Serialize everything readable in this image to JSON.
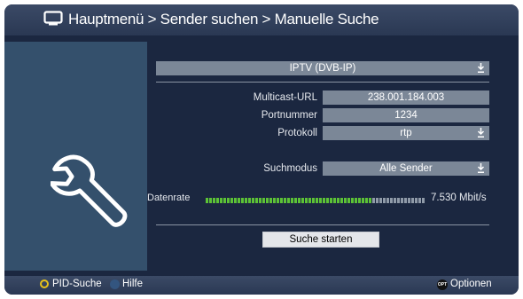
{
  "header": {
    "title": "Hauptmenü > Sender suchen > Manuelle Suche"
  },
  "source_select": {
    "value": "IPTV (DVB-IP)"
  },
  "form": {
    "multicast_url": {
      "label": "Multicast-URL",
      "value": "238.001.184.003"
    },
    "port": {
      "label": "Portnummer",
      "value": "1234"
    },
    "protocol": {
      "label": "Protokoll",
      "value": "rtp"
    },
    "search_mode": {
      "label": "Suchmodus",
      "value": "Alle Sender"
    }
  },
  "datarate": {
    "label": "Datenrate",
    "value": "7.530 Mbit/s",
    "level": 0.76,
    "filled_color": "#5cc236",
    "empty_color": "#8f9aa8"
  },
  "start_button": {
    "label": "Suche starten"
  },
  "footer": {
    "pid_search": {
      "label": "PID-Suche",
      "button_color": "#e8c21a"
    },
    "help": {
      "label": "Hilfe",
      "button_color": "#33557f"
    },
    "options": {
      "label": "Optionen",
      "icon_text": "OPT"
    }
  },
  "icons": {
    "header": "tv-icon",
    "panel": "wrench-icon",
    "dropdown": "arrow-down-icon"
  }
}
